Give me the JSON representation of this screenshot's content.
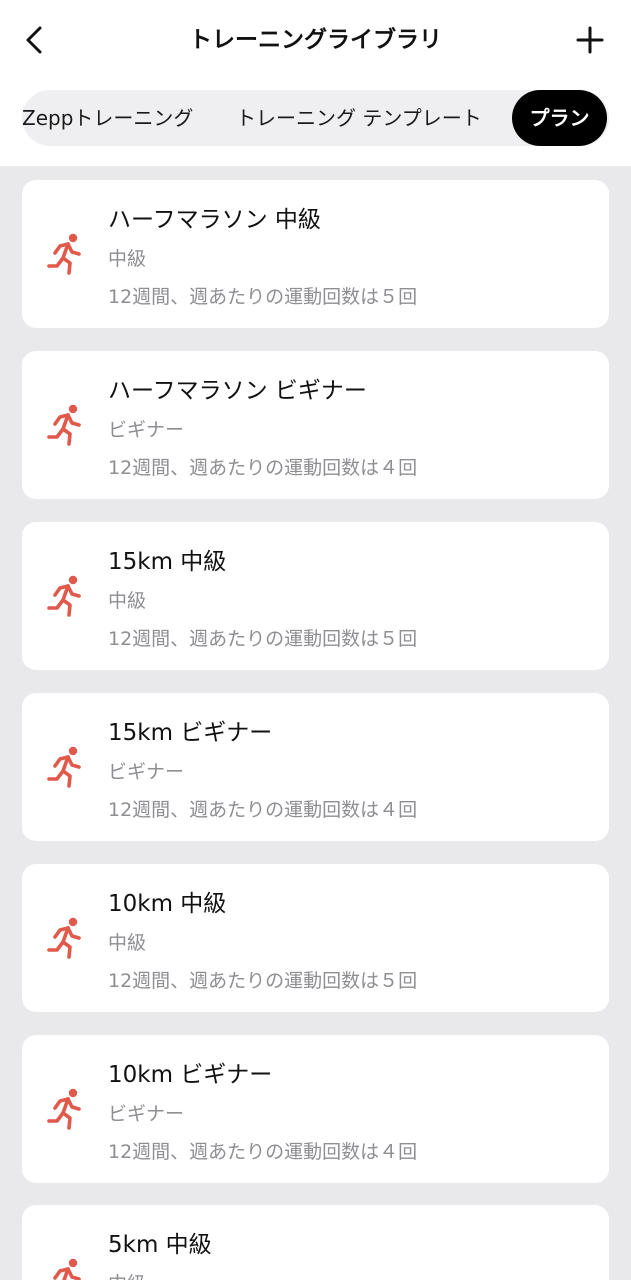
{
  "header": {
    "title": "トレーニングライブラリ",
    "back_icon": "chevron-left-icon",
    "add_icon": "plus-icon"
  },
  "tabs": [
    {
      "label": "Zeppトレーニング",
      "selected": false
    },
    {
      "label": "トレーニング テンプレート",
      "selected": false
    },
    {
      "label": "プラン",
      "selected": true
    }
  ],
  "colors": {
    "accent_icon": "#e0594b",
    "selected_tab_bg": "#000000",
    "background": "#e9e9ec"
  },
  "plans": [
    {
      "title": "ハーフマラソン 中級",
      "level": "中級",
      "description": "12週間、週あたりの運動回数は５回",
      "icon": "running-icon"
    },
    {
      "title": "ハーフマラソン ビギナー",
      "level": "ビギナー",
      "description": "12週間、週あたりの運動回数は４回",
      "icon": "running-icon"
    },
    {
      "title": "15km 中級",
      "level": "中級",
      "description": "12週間、週あたりの運動回数は５回",
      "icon": "running-icon"
    },
    {
      "title": "15km ビギナー",
      "level": "ビギナー",
      "description": "12週間、週あたりの運動回数は４回",
      "icon": "running-icon"
    },
    {
      "title": "10km 中級",
      "level": "中級",
      "description": "12週間、週あたりの運動回数は５回",
      "icon": "running-icon"
    },
    {
      "title": "10km ビギナー",
      "level": "ビギナー",
      "description": "12週間、週あたりの運動回数は４回",
      "icon": "running-icon"
    },
    {
      "title": "5km 中級",
      "level": "中級",
      "description": "",
      "icon": "running-icon"
    }
  ]
}
